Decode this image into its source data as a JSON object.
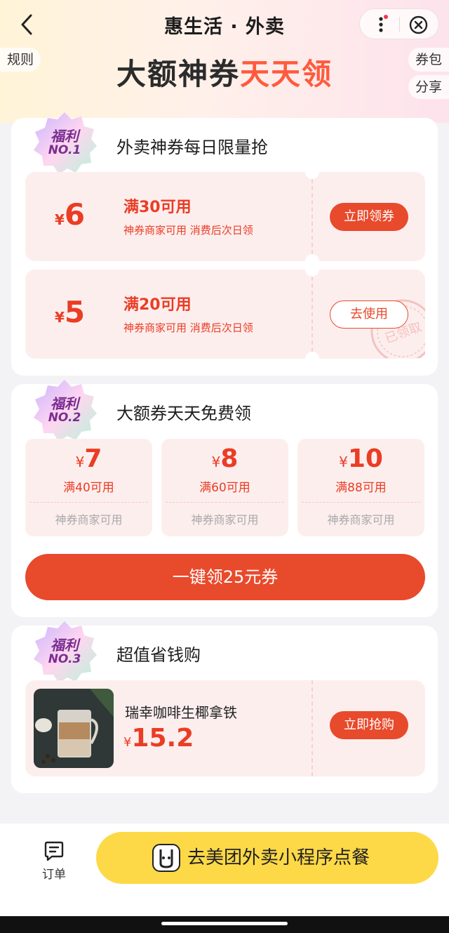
{
  "header": {
    "title": "惠生活 · 外卖",
    "rules": "规则",
    "coupons": "券包",
    "share": "分享",
    "banner_part1": "大额神券",
    "banner_part2": "天天领"
  },
  "section1": {
    "badge_top": "福利",
    "badge_bottom": "NO.1",
    "title": "外卖神券每日限量抢",
    "coupons": [
      {
        "currency": "¥",
        "amount": "6",
        "condition": "满30可用",
        "desc": "神券商家可用 消费后次日领",
        "action": "立即领券"
      },
      {
        "currency": "¥",
        "amount": "5",
        "condition": "满20可用",
        "desc": "神券商家可用 消费后次日领",
        "action": "去使用",
        "stamp": "已领取"
      }
    ]
  },
  "section2": {
    "badge_top": "福利",
    "badge_bottom": "NO.2",
    "title": "大额券天天免费领",
    "coupons": [
      {
        "currency": "¥",
        "amount": "7",
        "condition": "满40可用",
        "desc": "神券商家可用"
      },
      {
        "currency": "¥",
        "amount": "8",
        "condition": "满60可用",
        "desc": "神券商家可用"
      },
      {
        "currency": "¥",
        "amount": "10",
        "condition": "满88可用",
        "desc": "神券商家可用"
      }
    ],
    "claim_all": "一键领25元券"
  },
  "section3": {
    "badge_top": "福利",
    "badge_bottom": "NO.3",
    "title": "超值省钱购",
    "product": {
      "name": "瑞幸咖啡生椰拿铁",
      "currency": "¥",
      "price": "15.2",
      "action": "立即抢购"
    }
  },
  "bottom": {
    "order_label": "订单",
    "cta": "去美团外卖小程序点餐"
  },
  "colors": {
    "accent": "#e84a2c",
    "coupon_bg": "#fdeeee",
    "cta_yellow": "#fdd947"
  }
}
